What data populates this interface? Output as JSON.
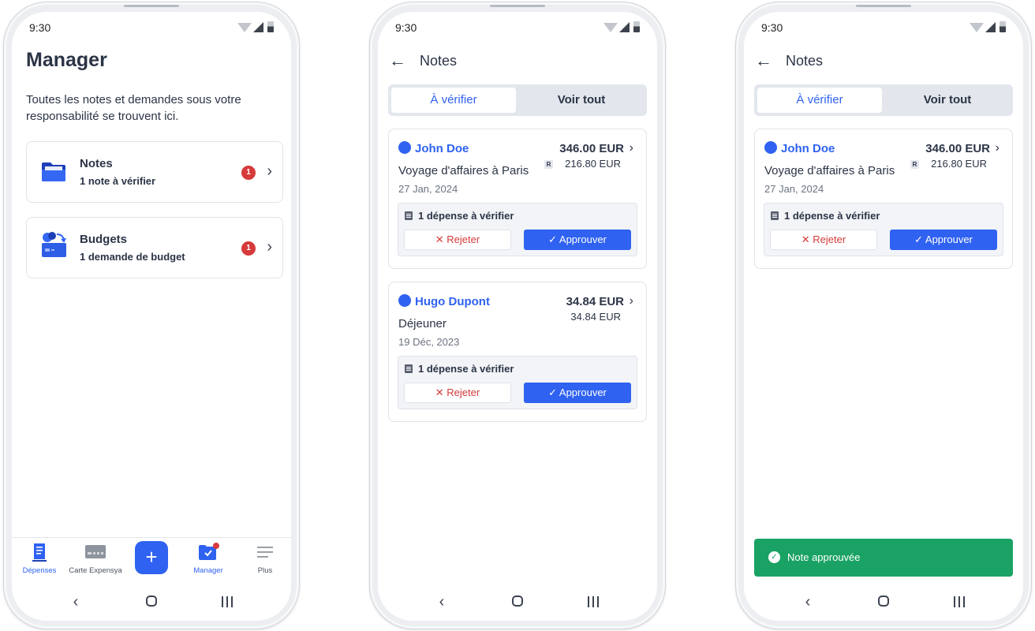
{
  "status": {
    "time": "9:30"
  },
  "screen1": {
    "title": "Manager",
    "description": "Toutes les notes et demandes sous votre responsabilité se trouvent ici.",
    "cards": [
      {
        "title": "Notes",
        "subtitle": "1 note à vérifier",
        "badge": "1",
        "icon": "folder-icon"
      },
      {
        "title": "Budgets",
        "subtitle": "1 demande de budget",
        "badge": "1",
        "icon": "budget-card-icon"
      }
    ],
    "tabs": [
      {
        "label": "Dépenses",
        "icon": "receipt-icon",
        "active": true
      },
      {
        "label": "Carte Expensya",
        "icon": "credit-card-icon",
        "active": false
      },
      {
        "label": "+",
        "icon": "plus-icon"
      },
      {
        "label": "Manager",
        "icon": "manager-folder-icon",
        "active": true
      },
      {
        "label": "Plus",
        "icon": "menu-lines-icon",
        "active": false
      }
    ]
  },
  "notes_screen": {
    "title": "Notes",
    "segments": {
      "active": "À vérifier",
      "inactive": "Voir tout"
    },
    "notes": [
      {
        "person": "John Doe",
        "description": "Voyage d'affaires à Paris",
        "date": "27 Jan, 2024",
        "amount": "346.00 EUR",
        "converted_badge": "R",
        "converted": "216.80 EUR",
        "pending": "1 dépense à vérifier",
        "reject": "Rejeter",
        "approve": "Approuver"
      },
      {
        "person": "Hugo Dupont",
        "description": "Déjeuner",
        "date": "19 Déc, 2023",
        "amount": "34.84 EUR",
        "converted": "34.84 EUR",
        "pending": "1 dépense à vérifier",
        "reject": "Rejeter",
        "approve": "Approuver"
      }
    ]
  },
  "toast": {
    "message": "Note approuvée"
  },
  "colors": {
    "accent": "#2f62f1",
    "danger": "#d63a3a",
    "success": "#1aa265"
  }
}
